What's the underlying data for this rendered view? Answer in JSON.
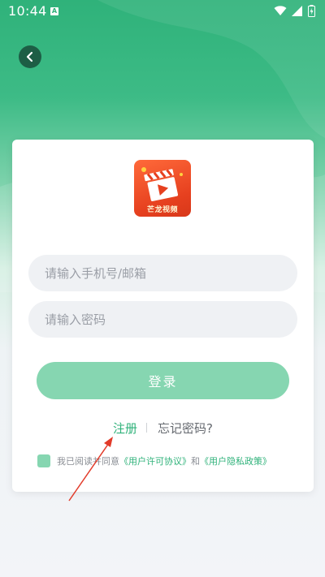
{
  "status_bar": {
    "time": "10:44",
    "notification_badge": "A",
    "icons": [
      "wifi-icon",
      "signal-icon",
      "battery-charging-icon"
    ]
  },
  "nav": {
    "back_icon": "chevron-left-icon"
  },
  "logo": {
    "text": "芒龙视频",
    "icon": "film-clapper-icon"
  },
  "form": {
    "phone_placeholder": "请输入手机号/邮箱",
    "phone_value": "",
    "password_placeholder": "请输入密码",
    "password_value": "",
    "login_label": "登录",
    "register_label": "注册",
    "forgot_label": "忘记密码?"
  },
  "agreement": {
    "prefix": "我已阅读并同意",
    "user_license": "《用户许可协议》",
    "conjunction": "和",
    "privacy_policy": "《用户隐私政策》",
    "checked": true
  },
  "colors": {
    "brand_green": "#2fb27a",
    "button_green_disabled": "#86d6b1",
    "annotation_arrow": "#e23b2a"
  }
}
